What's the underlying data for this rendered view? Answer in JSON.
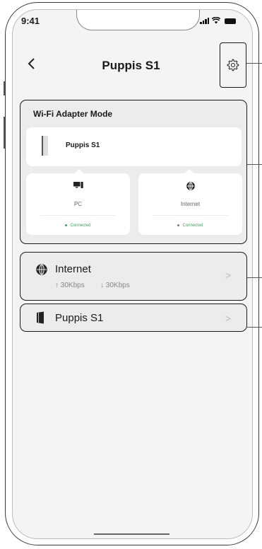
{
  "status_bar": {
    "time": "9:41"
  },
  "header": {
    "title": "Puppis S1",
    "back_icon": "chevron-left-icon",
    "settings_icon": "gear-icon"
  },
  "adapter_card": {
    "title": "Wi-Fi Adapter Mode",
    "device_name": "Puppis S1",
    "nodes": [
      {
        "label": "PC",
        "status": "Connected",
        "icon": "pc-icon"
      },
      {
        "label": "Internet",
        "status": "Connected",
        "icon": "globe-icon"
      }
    ]
  },
  "internet_item": {
    "label": "Internet",
    "upload": "↑ 30Kbps",
    "download": "↓ 30Kbps",
    "chevron": ">"
  },
  "device_item": {
    "label": "Puppis S1",
    "chevron": ">"
  },
  "colors": {
    "connected": "#3aa55d",
    "card_bg": "#ececec",
    "screen_bg": "#f4f4f4"
  }
}
